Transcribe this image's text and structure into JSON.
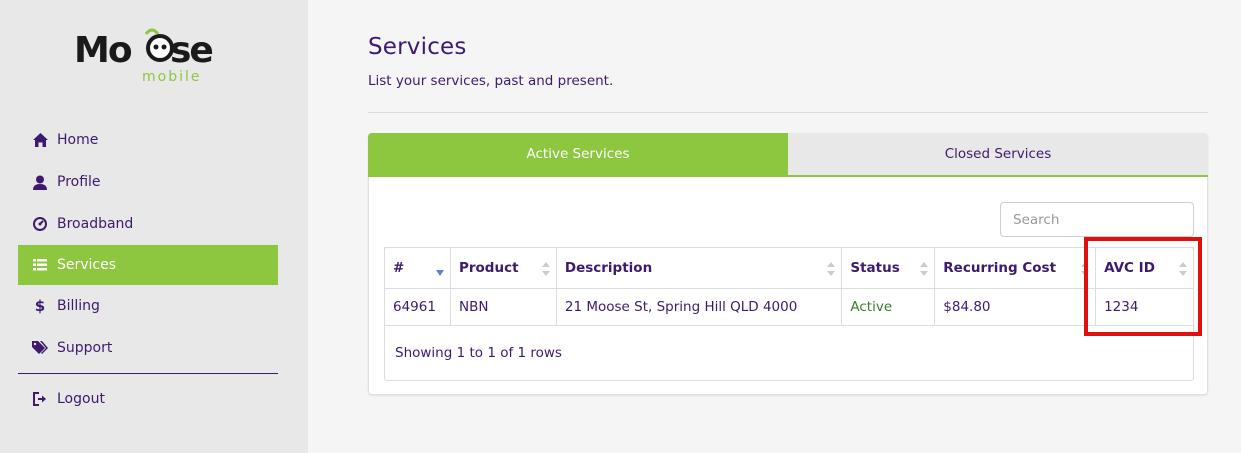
{
  "brand": {
    "logo_word": "Moose",
    "logo_sub": "mobile",
    "accent": "#8dc63f",
    "primary": "#3d1a6e"
  },
  "sidebar": {
    "items": [
      {
        "label": "Home",
        "icon": "home-icon"
      },
      {
        "label": "Profile",
        "icon": "user-icon"
      },
      {
        "label": "Broadband",
        "icon": "dashboard-icon"
      },
      {
        "label": "Services",
        "icon": "list-icon",
        "active": true
      },
      {
        "label": "Billing",
        "icon": "dollar-icon"
      },
      {
        "label": "Support",
        "icon": "tags-icon"
      }
    ],
    "logout": {
      "label": "Logout",
      "icon": "logout-icon"
    }
  },
  "page": {
    "title": "Services",
    "subtitle": "List your services, past and present."
  },
  "tabs": [
    {
      "label": "Active Services",
      "active": true
    },
    {
      "label": "Closed Services",
      "active": false
    }
  ],
  "search": {
    "placeholder": "Search",
    "value": ""
  },
  "table": {
    "columns": [
      "#",
      "Product",
      "Description",
      "Status",
      "Recurring Cost",
      "AVC ID"
    ],
    "rows": [
      [
        "64961",
        "NBN",
        "21 Moose St, Spring Hill QLD 4000",
        "Active",
        "$84.80",
        "1234"
      ]
    ],
    "footer": "Showing 1 to 1 of 1 rows"
  }
}
